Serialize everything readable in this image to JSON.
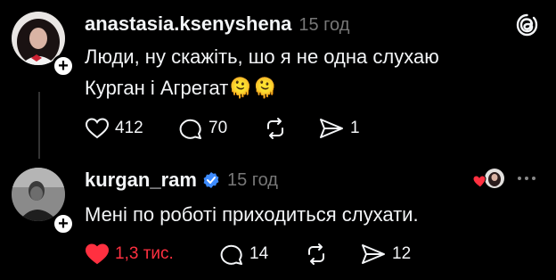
{
  "posts": [
    {
      "username": "anastasia.ksenyshena",
      "time": "15 год",
      "text_line1": "Люди, ну скажіть, шо я не одна слухаю",
      "text_line2": "Курган і Агрегат",
      "emoji": "🫠🫠",
      "likes": "412",
      "comments": "70",
      "reposts": "",
      "shares": "1",
      "liked": false
    },
    {
      "username": "kurgan_ram",
      "verified": true,
      "time": "15 год",
      "text_line1": "Мені по роботі приходиться слухати.",
      "likes": "1,3 тис.",
      "comments": "14",
      "reposts": "",
      "shares": "12",
      "liked": true
    }
  ],
  "colors": {
    "like": "#ff3040",
    "verified": "#3d8bff",
    "muted": "#777777"
  },
  "icons": [
    "threads-logo-icon",
    "heart-icon",
    "comment-icon",
    "repost-icon",
    "share-icon",
    "more-icon",
    "verified-badge-icon"
  ]
}
